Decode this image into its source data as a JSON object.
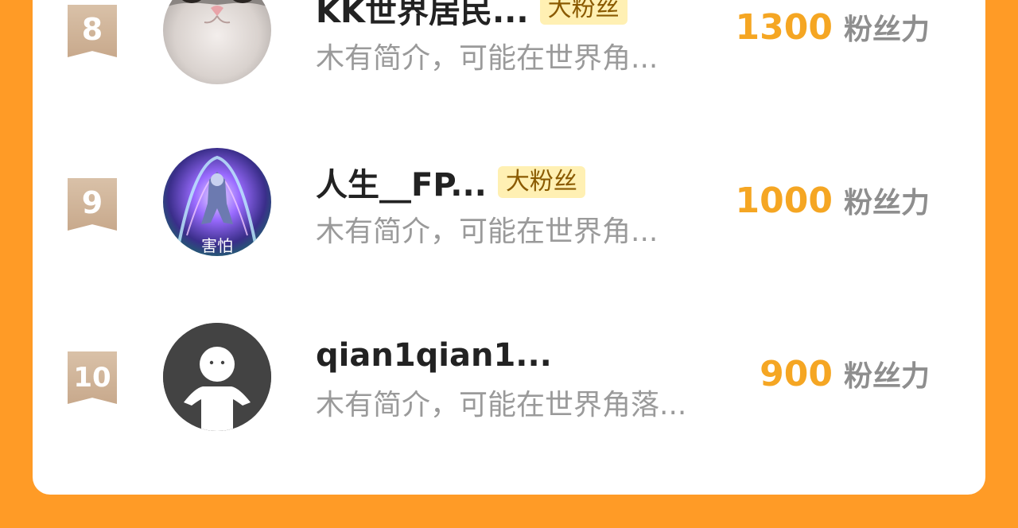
{
  "fans_list": [
    {
      "rank": "8",
      "name": "KK世界居民...",
      "badge": "大粉丝",
      "bio": "木有简介，可能在世界角...",
      "score": "1300",
      "score_unit": "粉丝力",
      "avatar_icon": "cat-avatar-icon"
    },
    {
      "rank": "9",
      "name": "人生__FP...",
      "badge": "大粉丝",
      "bio": "木有简介，可能在世界角...",
      "score": "1000",
      "score_unit": "粉丝力",
      "avatar_icon": "game-character-avatar-icon",
      "avatar_caption": "害怕"
    },
    {
      "rank": "10",
      "name": "qian1qian1...",
      "badge": "",
      "bio": "木有简介，可能在世界角落...",
      "score": "900",
      "score_unit": "粉丝力",
      "avatar_icon": "default-user-avatar-icon"
    }
  ],
  "colors": {
    "page_background": "#FF9B26",
    "card_background": "#FFFFFF",
    "score_color": "#F5A623",
    "badge_background": "#FFF0B3",
    "rank_ribbon": "#C8A98C"
  }
}
